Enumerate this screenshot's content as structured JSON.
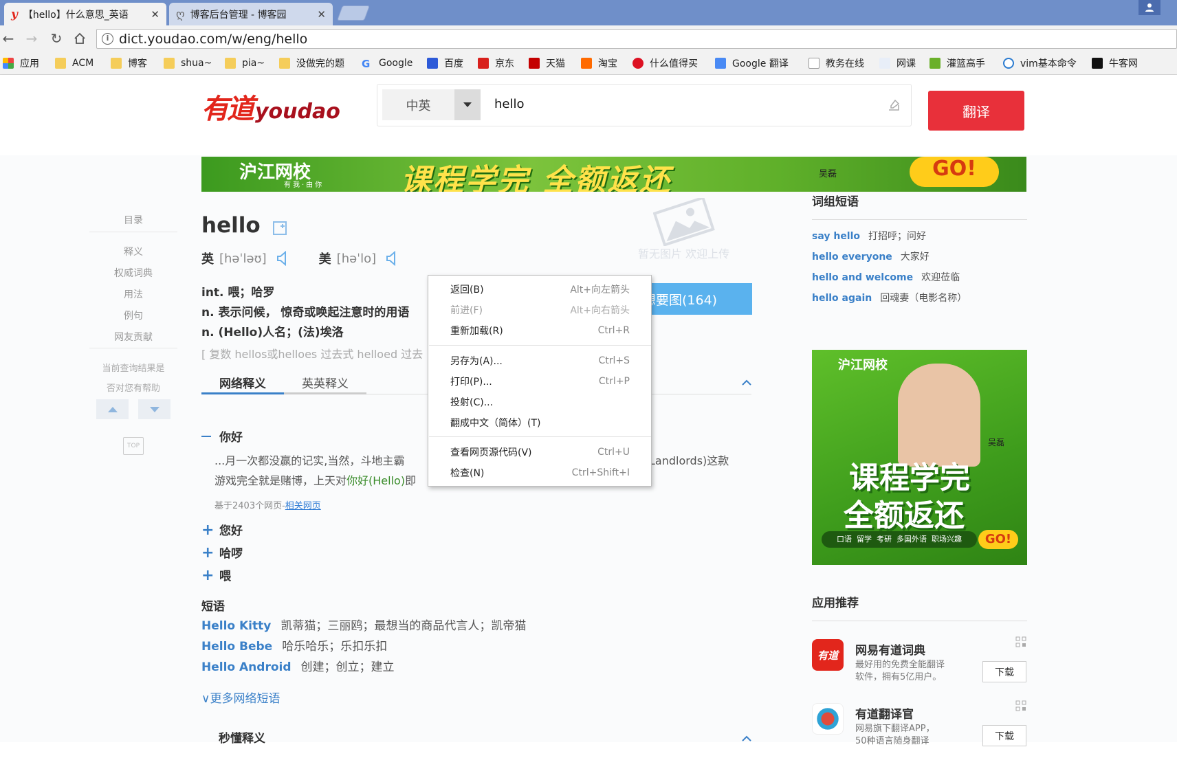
{
  "browser": {
    "tabs": [
      {
        "title": "【hello】什么意思_英语"
      },
      {
        "title": "博客后台管理 - 博客园"
      }
    ],
    "url": "dict.youdao.com/w/eng/hello",
    "bookmarks": [
      "应用",
      "ACM",
      "博客",
      "shua~",
      "pia~",
      "没做完的题",
      "Google",
      "百度",
      "京东",
      "天猫",
      "淘宝",
      "什么值得买",
      "Google 翻译",
      "教务在线",
      "网课",
      "灌篮高手",
      "vim基本命令",
      "牛客网"
    ]
  },
  "header": {
    "logo_cn": "有道",
    "logo_en": "youdao",
    "lang": "中英",
    "query": "hello",
    "translate_label": "翻译"
  },
  "banner": {
    "brand": "沪江网校",
    "brand_sub": "有我·由你",
    "slogan": "课程学完 全额返还",
    "name": "吴磊",
    "go": "GO!"
  },
  "sidenav": {
    "toc": "目录",
    "items": [
      "释义",
      "权威词典",
      "用法",
      "例句",
      "网友贡献"
    ],
    "feedback_q": "当前查询结果是",
    "feedback_q2": "否对您有帮助",
    "top": "TOP"
  },
  "word": {
    "headword": "hello",
    "uk_label": "英",
    "uk_ipa": "[həˈləʊ]",
    "us_label": "美",
    "us_ipa": "[həˈlo]",
    "defs": [
      "int. 喂；哈罗",
      "n. 表示问候， 惊奇或唤起注意时的用语",
      "n. (Hello)人名；(法)埃洛"
    ],
    "forms": "[ 复数 hellos或helloes 过去式 helloed 过去",
    "no_image": "暂无图片 欢迎上传",
    "want_image": "我想要图(164)"
  },
  "tabs": {
    "web": "网络释义",
    "ee": "英英释义"
  },
  "web_def": {
    "main": "你好",
    "excerpt1": "...月一次都没赢的记实,当然，斗地主霸",
    "excerpt1b": "Landlords)这款",
    "excerpt2": "游戏完全就是赌博，上天对",
    "excerpt2_hl": "你好(Hello)",
    "excerpt2_tail": "即",
    "source": "基于2403个网页-",
    "source_link": "相关网页",
    "others": [
      "您好",
      "哈啰",
      "喂"
    ]
  },
  "phrases": {
    "title": "短语",
    "items": [
      {
        "en": "Hello Kitty",
        "cn": "凯蒂猫；三丽鸥；最想当的商品代言人；凯帝猫"
      },
      {
        "en": "Hello Bebe",
        "cn": "哈乐哈乐；乐扣乐扣"
      },
      {
        "en": "Hello Android",
        "cn": "创建；创立；建立"
      }
    ],
    "more": "更多网络短语",
    "next_section": "秒懂释义"
  },
  "sidebar": {
    "phrase_title": "词组短语",
    "phrases": [
      {
        "en": "say hello",
        "cn": "打招呼；问好"
      },
      {
        "en": "hello everyone",
        "cn": "大家好"
      },
      {
        "en": "hello and welcome",
        "cn": "欢迎莅临"
      },
      {
        "en": "hello again",
        "cn": "回魂妻（电影名称）"
      }
    ],
    "ad": {
      "brand": "沪江网校",
      "name": "吴磊",
      "line1": "课程学完",
      "line2": "全额返还",
      "tags": "口语  留学  考研  多国外语  职场兴趣",
      "go": "GO!"
    },
    "apps_title": "应用推荐",
    "apps": [
      {
        "icon_text": "有道",
        "name": "网易有道词典",
        "desc1": "最好用的免费全能翻译",
        "desc2": "软件，拥有5亿用户。",
        "btn": "下载"
      },
      {
        "name": "有道翻译官",
        "desc1": "网易旗下翻译APP，",
        "desc2": "50种语言随身翻译",
        "btn": "下载"
      }
    ]
  },
  "context_menu": {
    "group1": [
      {
        "label": "返回(B)",
        "shortcut": "Alt+向左箭头",
        "disabled": false
      },
      {
        "label": "前进(F)",
        "shortcut": "Alt+向右箭头",
        "disabled": true
      },
      {
        "label": "重新加载(R)",
        "shortcut": "Ctrl+R",
        "disabled": false
      }
    ],
    "group2": [
      {
        "label": "另存为(A)...",
        "shortcut": "Ctrl+S"
      },
      {
        "label": "打印(P)...",
        "shortcut": "Ctrl+P"
      },
      {
        "label": "投射(C)...",
        "shortcut": ""
      },
      {
        "label": "翻成中文（简体）(T)",
        "shortcut": ""
      }
    ],
    "group3": [
      {
        "label": "查看网页源代码(V)",
        "shortcut": "Ctrl+U"
      },
      {
        "label": "检查(N)",
        "shortcut": "Ctrl+Shift+I"
      }
    ]
  },
  "colors": {
    "accent_red": "#e8303a",
    "link_blue": "#3a80c8",
    "tab_blue": "#6f8fc9",
    "want_img_blue": "#5ab2ee"
  }
}
